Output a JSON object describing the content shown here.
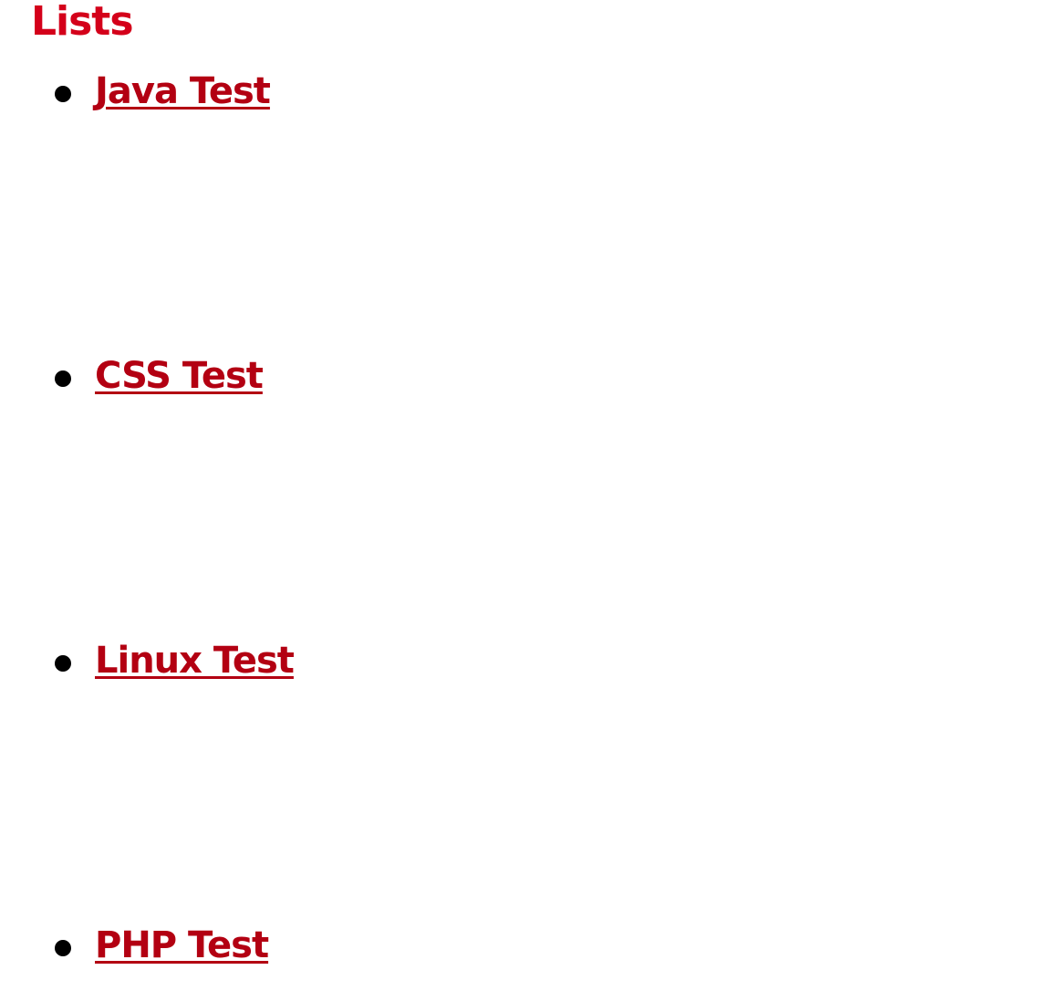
{
  "page": {
    "heading": "Lists",
    "heading_color": "#d4001a",
    "link_color": "#b30012"
  },
  "list": {
    "items": [
      {
        "label": "Java Test"
      },
      {
        "label": "CSS Test"
      },
      {
        "label": "Linux Test"
      },
      {
        "label": "PHP Test"
      }
    ]
  }
}
